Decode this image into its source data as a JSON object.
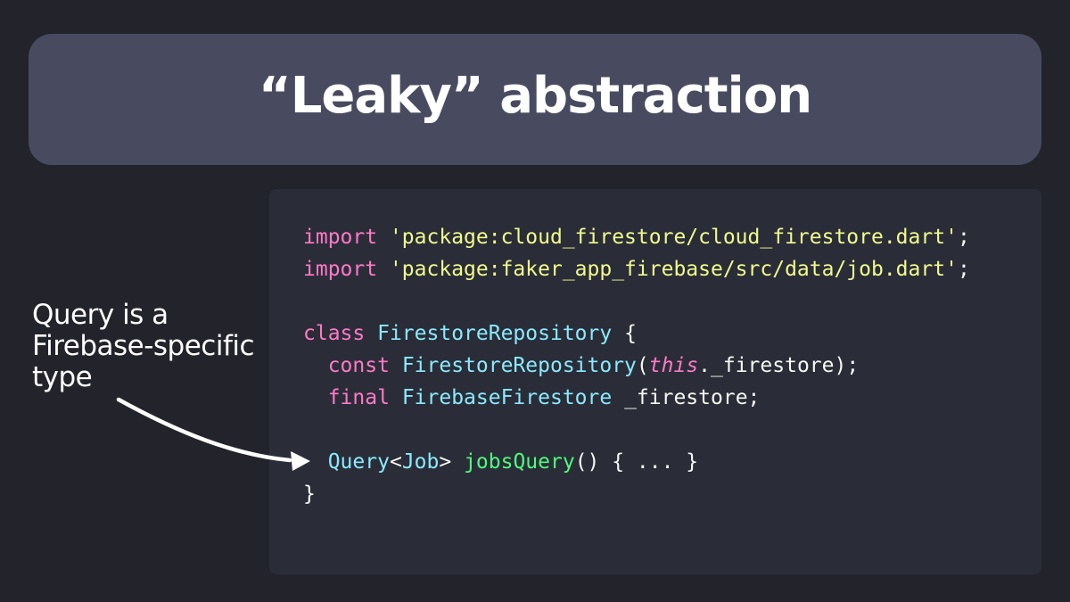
{
  "colors": {
    "background": "#23232c",
    "title_bar": "#484b60",
    "title_text": "#ffffff",
    "code_panel": "#2a2d38",
    "plain": "#f8f8f2",
    "keyword": "#ff79c6",
    "string": "#f1fa8c",
    "type": "#8be9fd",
    "function": "#50fa7b",
    "annotation": "#ffffff",
    "arrow": "#ffffff"
  },
  "title": "“Leaky” abstraction",
  "annotation": {
    "lines": [
      "Query is a",
      "Firebase-specific",
      "type"
    ]
  },
  "code": {
    "lines": [
      [
        {
          "t": "import",
          "k": "keyword"
        },
        {
          "t": " ",
          "k": "plain"
        },
        {
          "t": "'package:cloud_firestore/cloud_firestore.dart'",
          "k": "string"
        },
        {
          "t": ";",
          "k": "plain"
        }
      ],
      [
        {
          "t": "import",
          "k": "keyword"
        },
        {
          "t": " ",
          "k": "plain"
        },
        {
          "t": "'package:faker_app_firebase/src/data/job.dart'",
          "k": "string"
        },
        {
          "t": ";",
          "k": "plain"
        }
      ],
      [],
      [
        {
          "t": "class",
          "k": "keyword"
        },
        {
          "t": " ",
          "k": "plain"
        },
        {
          "t": "FirestoreRepository",
          "k": "type"
        },
        {
          "t": " {",
          "k": "plain"
        }
      ],
      [
        {
          "t": "  ",
          "k": "plain"
        },
        {
          "t": "const",
          "k": "keyword"
        },
        {
          "t": " ",
          "k": "plain"
        },
        {
          "t": "FirestoreRepository",
          "k": "type"
        },
        {
          "t": "(",
          "k": "plain"
        },
        {
          "t": "this",
          "k": "keyword",
          "i": true
        },
        {
          "t": "._firestore);",
          "k": "plain"
        }
      ],
      [
        {
          "t": "  ",
          "k": "plain"
        },
        {
          "t": "final",
          "k": "keyword"
        },
        {
          "t": " ",
          "k": "plain"
        },
        {
          "t": "FirebaseFirestore",
          "k": "type"
        },
        {
          "t": " _firestore;",
          "k": "plain"
        }
      ],
      [],
      [
        {
          "t": "  ",
          "k": "plain"
        },
        {
          "t": "Query",
          "k": "type"
        },
        {
          "t": "<",
          "k": "plain"
        },
        {
          "t": "Job",
          "k": "type"
        },
        {
          "t": "> ",
          "k": "plain"
        },
        {
          "t": "jobsQuery",
          "k": "function"
        },
        {
          "t": "() { ... }",
          "k": "plain"
        }
      ],
      [
        {
          "t": "}",
          "k": "plain"
        }
      ]
    ]
  }
}
